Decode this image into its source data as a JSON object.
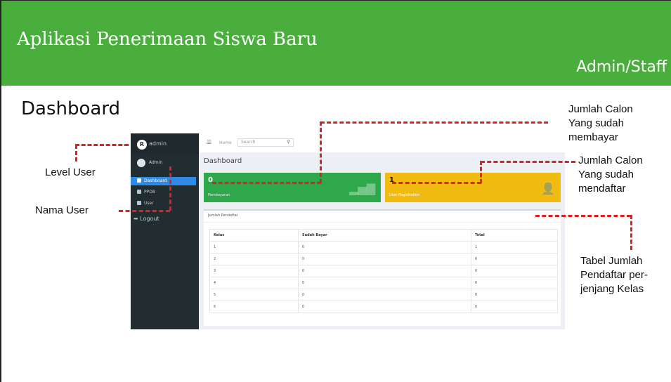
{
  "banner": {
    "title": "Aplikasi Penerimaan Siswa Baru",
    "role": "Admin/Staff"
  },
  "page_heading": "Dashboard",
  "annotations": {
    "level_user": "Level User",
    "nama_user": "Nama User",
    "paid_lines": [
      "Jumlah Calon",
      "Yang sudah",
      "membayar"
    ],
    "registered_lines": [
      "Jumlah Calon",
      "Yang sudah",
      "mendaftar"
    ],
    "table_lines": [
      "Tabel Jumlah",
      "Pendaftar per-",
      "jenjang Kelas"
    ]
  },
  "app": {
    "brand": "admin",
    "user_name": "Admin",
    "logo_letter": "R",
    "sidebar_items": [
      {
        "label": "Dashboard",
        "icon": "dashboard-icon",
        "active": true
      },
      {
        "label": "PPDB",
        "icon": "file-icon",
        "active": false
      },
      {
        "label": "User",
        "icon": "users-icon",
        "active": false
      }
    ],
    "logout_label": "Logout",
    "topbar": {
      "menu_icon": "☰",
      "home_label": "Home",
      "search_placeholder": "Search",
      "search_icon": "⚲"
    },
    "content_title": "Dashboard",
    "boxes": {
      "paid": {
        "value": "0",
        "label": "Pembayaran",
        "icon": "bar-chart-icon",
        "color": "#2ea84a"
      },
      "registered": {
        "value": "1",
        "label": "User Registration",
        "icon": "user-plus-icon",
        "color": "#f2bb12"
      }
    },
    "panel_title": "Jumlah Pendaftar",
    "table": {
      "columns": [
        "Kelas",
        "Sudah Bayar",
        "Total"
      ],
      "rows": [
        [
          "1",
          "0",
          "1"
        ],
        [
          "2",
          "0",
          "0"
        ],
        [
          "3",
          "0",
          "0"
        ],
        [
          "4",
          "0",
          "0"
        ],
        [
          "5",
          "0",
          "0"
        ],
        [
          "6",
          "0",
          "0"
        ]
      ]
    }
  }
}
